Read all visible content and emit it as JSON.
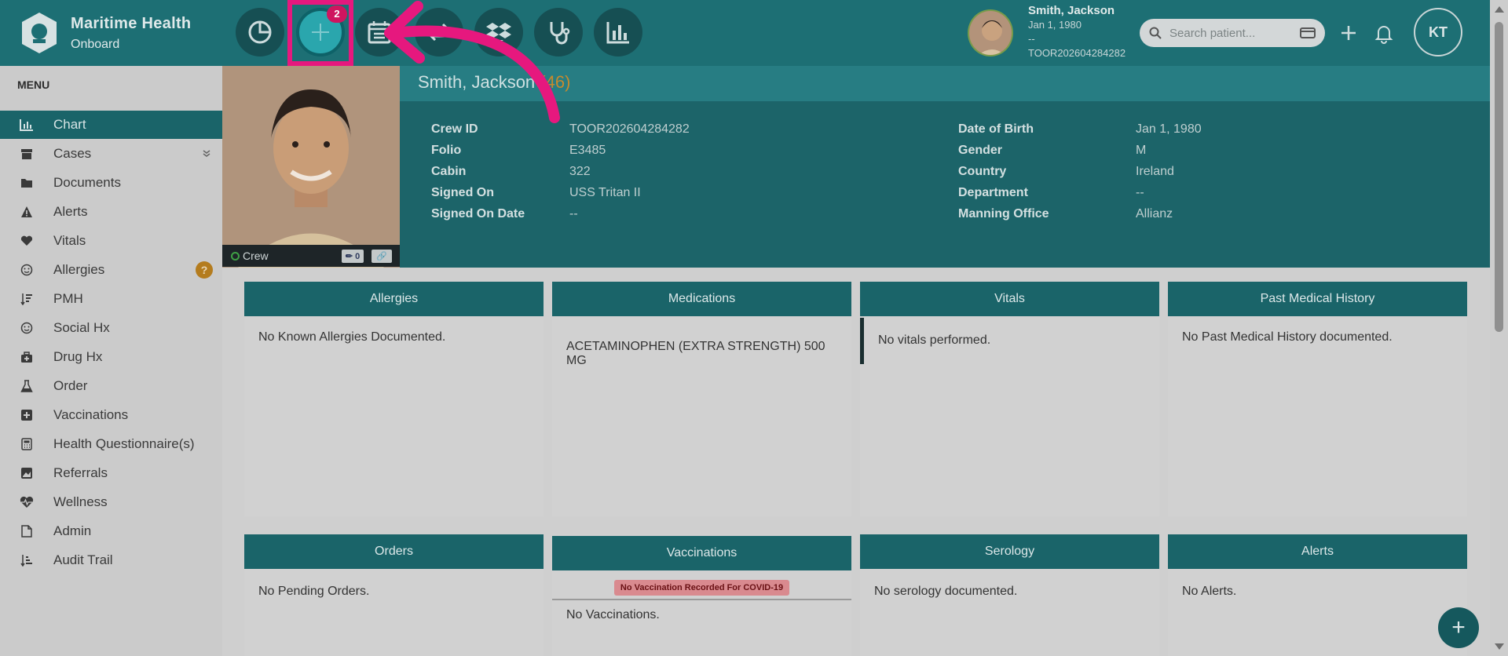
{
  "brand": {
    "title": "Maritime Health",
    "subtitle": "Onboard"
  },
  "nav": {
    "items": [
      {
        "name": "dashboard",
        "icon": "pie-chart-icon"
      },
      {
        "name": "add-new",
        "icon": "plus-icon",
        "badge": "2"
      },
      {
        "name": "calendar",
        "icon": "calendar-icon"
      },
      {
        "name": "transfer",
        "icon": "arrows-icon"
      },
      {
        "name": "dropbox",
        "icon": "dropbox-icon"
      },
      {
        "name": "clinical",
        "icon": "stethoscope-icon"
      },
      {
        "name": "reports",
        "icon": "bar-chart-icon"
      }
    ]
  },
  "patient_chip": {
    "name": "Smith, Jackson",
    "dob": "Jan 1, 1980",
    "extra": "--",
    "crew_id": "TOOR202604284282"
  },
  "search": {
    "placeholder": "Search patient..."
  },
  "user": {
    "initials": "KT"
  },
  "sidebar": {
    "title": "MENU",
    "items": [
      {
        "label": "Chart",
        "icon": "bar-chart-icon",
        "active": true
      },
      {
        "label": "Cases",
        "icon": "archive-icon",
        "extra": "chevron-down-icon"
      },
      {
        "label": "Documents",
        "icon": "folder-icon"
      },
      {
        "label": "Alerts",
        "icon": "warning-icon"
      },
      {
        "label": "Vitals",
        "icon": "heart-icon"
      },
      {
        "label": "Allergies",
        "icon": "smiley-icon",
        "extra": "help-badge-icon"
      },
      {
        "label": "PMH",
        "icon": "sort-icon"
      },
      {
        "label": "Social Hx",
        "icon": "smiley-icon"
      },
      {
        "label": "Drug Hx",
        "icon": "medkit-icon"
      },
      {
        "label": "Order",
        "icon": "flask-icon"
      },
      {
        "label": "Vaccinations",
        "icon": "plus-square-icon"
      },
      {
        "label": "Health Questionnaire(s)",
        "icon": "calculator-icon"
      },
      {
        "label": "Referrals",
        "icon": "image-icon"
      },
      {
        "label": "Wellness",
        "icon": "heartbeat-icon"
      },
      {
        "label": "Admin",
        "icon": "file-icon"
      },
      {
        "label": "Audit Trail",
        "icon": "sort-amount-icon"
      }
    ]
  },
  "patient": {
    "name": "Smith, Jackson",
    "age": "(46)",
    "role": "Crew",
    "share_count": "0",
    "left_fields": [
      {
        "label": "Crew ID",
        "value": "TOOR202604284282"
      },
      {
        "label": "Folio",
        "value": "E3485"
      },
      {
        "label": "Cabin",
        "value": "322"
      },
      {
        "label": "Signed On",
        "value": "USS Tritan II"
      },
      {
        "label": "Signed On Date",
        "value": "--"
      }
    ],
    "right_fields": [
      {
        "label": "Date of Birth",
        "value": "Jan 1, 1980"
      },
      {
        "label": "Gender",
        "value": "M"
      },
      {
        "label": "Country",
        "value": "Ireland"
      },
      {
        "label": "Department",
        "value": "--"
      },
      {
        "label": "Manning Office",
        "value": "Allianz"
      }
    ]
  },
  "cards": {
    "allergies": {
      "title": "Allergies",
      "body": "No Known Allergies Documented."
    },
    "medications": {
      "title": "Medications",
      "body": "ACETAMINOPHEN (EXTRA STRENGTH) 500 MG"
    },
    "vitals": {
      "title": "Vitals",
      "body": "No vitals performed."
    },
    "pmh": {
      "title": "Past Medical History",
      "body": "No Past Medical History documented."
    },
    "orders": {
      "title": "Orders",
      "body": "No Pending Orders."
    },
    "vaccinations": {
      "title": "Vaccinations",
      "notice": "No Vaccination Recorded For COVID-19",
      "body": "No Vaccinations."
    },
    "serology": {
      "title": "Serology",
      "body": "No serology documented."
    },
    "alerts": {
      "title": "Alerts",
      "body": "No Alerts."
    }
  },
  "colors": {
    "accent": "#e6187e",
    "teal": "#1a6469",
    "age": "#c58a2e"
  }
}
